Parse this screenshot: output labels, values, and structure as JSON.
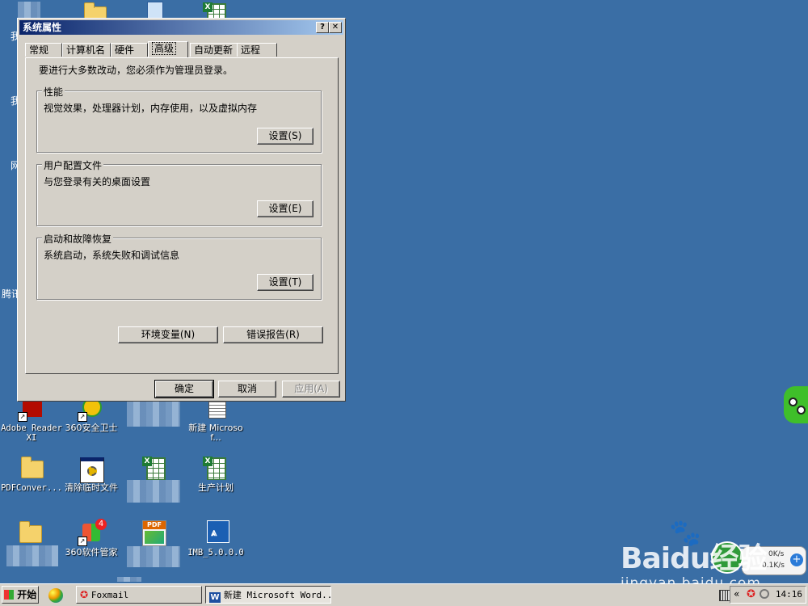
{
  "dialog": {
    "title": "系统属性",
    "help_btn": "?",
    "close_btn": "✕",
    "tabs": [
      "常规",
      "计算机名",
      "硬件",
      "高级",
      "自动更新",
      "远程"
    ],
    "notice": "要进行大多数改动，您必须作为管理员登录。",
    "groups": [
      {
        "title": "性能",
        "desc": "视觉效果，处理器计划，内存使用，以及虚拟内存",
        "button": "设置(S)"
      },
      {
        "title": "用户配置文件",
        "desc": "与您登录有关的桌面设置",
        "button": "设置(E)"
      },
      {
        "title": "启动和故障恢复",
        "desc": "系统启动，系统失败和调试信息",
        "button": "设置(T)"
      }
    ],
    "env_button": "环境变量(N)",
    "error_button": "错误报告(R)",
    "ok": "确定",
    "cancel": "取消",
    "apply": "应用(A)"
  },
  "desktop": {
    "left_labels": [
      "我",
      "我",
      "网",
      "腾讯"
    ],
    "icons": [
      {
        "label": "Adobe Reader XI"
      },
      {
        "label": "360安全卫士"
      },
      {
        "label": "新建 Microsof..."
      },
      {
        "label": "PDFConver..."
      },
      {
        "label": "清除临时文件"
      },
      {
        "label": "生产计划"
      },
      {
        "label": "360软件管家"
      },
      {
        "label": "IMB_5.0.0.0"
      }
    ],
    "pdf_badge": "PDF",
    "badge_count": "4"
  },
  "taskbar": {
    "start": "开始",
    "items": [
      "Foxmail",
      "新建 Microsoft Word..."
    ],
    "clock": "14:16",
    "chevron": "«"
  },
  "netspeed": {
    "up": "0K/s",
    "down": "0.1K/s"
  },
  "watermark": {
    "brand": "Baidu经验",
    "url": "jingyan.baidu.com"
  },
  "colors": {
    "desktop": "#3a6ea5",
    "titlebar": "#0a246a",
    "face": "#d4d0c8"
  }
}
